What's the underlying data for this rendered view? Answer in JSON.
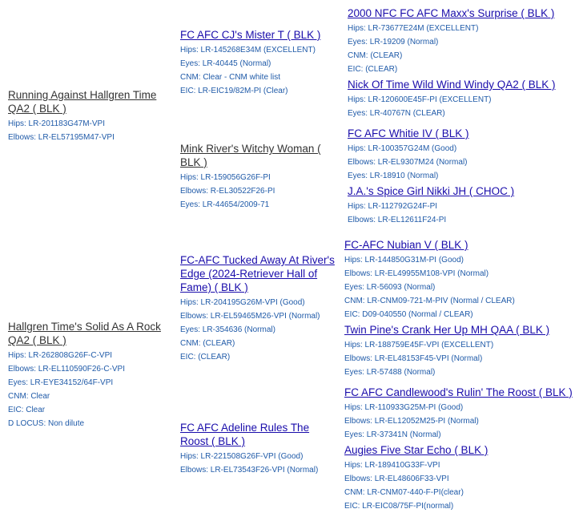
{
  "dogs": {
    "g1": {
      "name": "Running Against Hallgren Time QA2 ( BLK )",
      "details": [
        "Hips: LR-201183G47M-VPI",
        "Elbows: LR-EL57195M47-VPI"
      ]
    },
    "g2": {
      "name": "Hallgren Time's Solid As A Rock QA2 ( BLK )",
      "details": [
        "Hips: LR-262808G26F-C-VPI",
        "Elbows: LR-EL110590F26-C-VPI",
        "Eyes: LR-EYE34152/64F-VPI",
        "CNM: Clear",
        "EIC: Clear",
        "D LOCUS: Non dilute"
      ]
    },
    "p1": {
      "name": "FC AFC CJ's Mister T ( BLK )",
      "details": [
        "Hips: LR-145268E34M (EXCELLENT)",
        "Eyes: LR-40445 (Normal)",
        "CNM: Clear - CNM white list",
        "EIC: LR-EIC19/82M-PI (Clear)"
      ]
    },
    "p2": {
      "name": "Mink River's Witchy Woman ( BLK )",
      "details": [
        "Hips: LR-159056G26F-PI",
        "Elbows: R-EL30522F26-PI",
        "Eyes: LR-44654/2009-71"
      ]
    },
    "p3": {
      "name": "FC-AFC Tucked Away At River's Edge (2024-Retriever Hall of Fame) ( BLK )",
      "details": [
        "Hips: LR-204195G26M-VPI (Good)",
        "Elbows: LR-EL59465M26-VPI (Normal)",
        "Eyes: LR-354636 (Normal)",
        "CNM: (CLEAR)",
        "EIC: (CLEAR)"
      ]
    },
    "p4": {
      "name": "FC AFC Adeline Rules The Roost ( BLK )",
      "details": [
        "Hips: LR-221508G26F-VPI (Good)",
        "Elbows: LR-EL73543F26-VPI (Normal)"
      ]
    },
    "a1": {
      "name": "2000 NFC FC AFC Maxx's Surprise ( BLK )",
      "details": [
        "Hips: LR-73677E24M (EXCELLENT)",
        "Eyes: LR-19209 (Normal)",
        "CNM: (CLEAR)",
        "EIC: (CLEAR)"
      ]
    },
    "a2": {
      "name": "Nick Of Time Wild Wind Windy QA2 ( BLK )",
      "details": [
        "Hips: LR-120600E45F-PI (EXCELLENT)",
        "Eyes: LR-40767N (CLEAR)"
      ]
    },
    "a3": {
      "name": "FC AFC Whitie IV ( BLK )",
      "details": [
        "Hips: LR-100357G24M (Good)",
        "Elbows: LR-EL9307M24 (Normal)",
        "Eyes: LR-18910 (Normal)"
      ]
    },
    "a4": {
      "name": "J.A.'s Spice Girl Nikki JH ( CHOC )",
      "details": [
        "Hips: LR-112792G24F-PI",
        "Elbows: LR-EL12611F24-PI"
      ]
    },
    "a5": {
      "name": "FC-AFC Nubian V ( BLK )",
      "details": [
        "Hips: LR-144850G31M-PI (Good)",
        "Elbows: LR-EL49955M108-VPI (Normal)",
        "Eyes: LR-56093 (Normal)",
        "CNM: LR-CNM09-721-M-PIV (Normal / CLEAR)",
        "EIC: D09-040550 (Normal / CLEAR)"
      ]
    },
    "a6": {
      "name": "Twin Pine's Crank Her Up MH QAA ( BLK )",
      "details": [
        "Hips: LR-188759E45F-VPI (EXCELLENT)",
        "Elbows: LR-EL48153F45-VPI (Normal)",
        "Eyes: LR-57488 (Normal)"
      ]
    },
    "a7": {
      "name": "FC AFC Candlewood's Rulin' The Roost ( BLK )",
      "details": [
        "Hips: LR-110933G25M-PI (Good)",
        "Elbows: LR-EL12052M25-PI (Normal)",
        "Eyes: LR-37341N (Normal)"
      ]
    },
    "a8": {
      "name": "Augies Five Star Echo ( BLK )",
      "details": [
        "Hips: LR-189410G33F-VPI",
        "Elbows: LR-EL48606F33-VPI",
        "CNM: LR-CNM07-440-F-PI(clear)",
        "EIC: LR-EIC08/75F-PI(normal)"
      ]
    }
  }
}
